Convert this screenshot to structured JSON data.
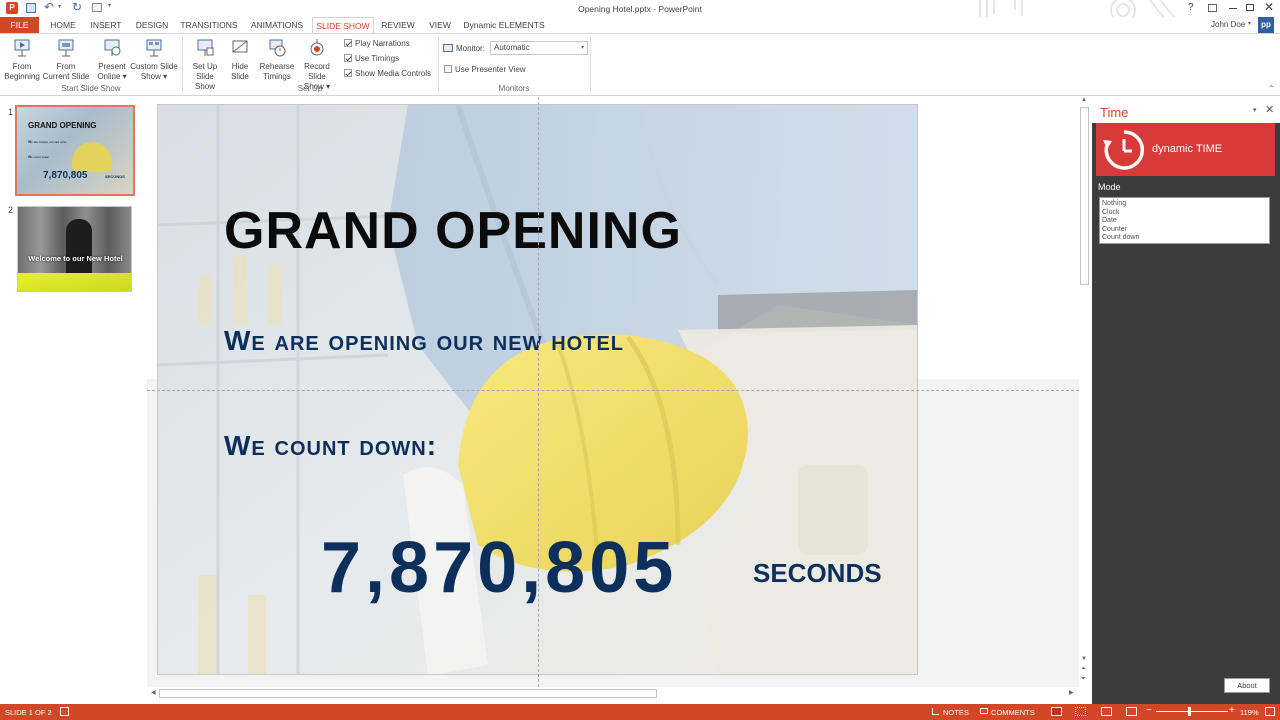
{
  "window": {
    "title": "Opening Hotel.pptx - PowerPoint",
    "user": "John Doe",
    "user_initials": "pp"
  },
  "tabs": [
    {
      "label": "FILE"
    },
    {
      "label": "HOME"
    },
    {
      "label": "INSERT"
    },
    {
      "label": "DESIGN"
    },
    {
      "label": "TRANSITIONS"
    },
    {
      "label": "ANIMATIONS"
    },
    {
      "label": "SLIDE SHOW"
    },
    {
      "label": "REVIEW"
    },
    {
      "label": "VIEW"
    },
    {
      "label": "Dynamic ELEMENTS"
    }
  ],
  "ribbon": {
    "from_beginning": [
      "From",
      "Beginning"
    ],
    "from_current": [
      "From",
      "Current Slide"
    ],
    "present_online": [
      "Present",
      "Online ▾"
    ],
    "custom_show": [
      "Custom Slide",
      "Show ▾"
    ],
    "setup_show": [
      "Set Up",
      "Slide Show"
    ],
    "hide_slide": [
      "Hide",
      "Slide"
    ],
    "rehearse": [
      "Rehearse",
      "Timings"
    ],
    "record": [
      "Record Slide",
      "Show ▾"
    ],
    "play_narrations": "Play Narrations",
    "use_timings": "Use Timings",
    "show_media_controls": "Show Media Controls",
    "monitor_label": "Monitor:",
    "monitor_value": "Automatic",
    "use_presenter_view": "Use Presenter View",
    "group_start": "Start Slide Show",
    "group_setup": "Set Up",
    "group_monitors": "Monitors"
  },
  "thumbnails": [
    {
      "num": "1",
      "title": "GRAND OPENING",
      "line1": "We are opening our new hotel",
      "line2": "We count down:",
      "count": "7,870,805",
      "unit": "SECONDS"
    },
    {
      "num": "2",
      "text": "Welcome to our New Hotel"
    }
  ],
  "slide": {
    "title": "GRAND OPENING",
    "line1": "We are opening our new hotel",
    "line2": "We count down:",
    "count": "7,870,805",
    "unit": "SECONDS"
  },
  "taskpane": {
    "title": "Time",
    "brand": "dynamic TIME",
    "mode_label": "Mode",
    "modes": [
      "Nothing",
      "Clock",
      "Date",
      "Counter",
      "Count down"
    ],
    "about": "About"
  },
  "status": {
    "slide": "SLIDE 1 OF 2",
    "notes": "NOTES",
    "comments": "COMMENTS",
    "zoom": "119%"
  },
  "colors": {
    "accent": "#d24726",
    "slide_text": "#0c2f5c",
    "pane_bg": "#3c3c3c",
    "brand_red": "#d83a3a"
  }
}
